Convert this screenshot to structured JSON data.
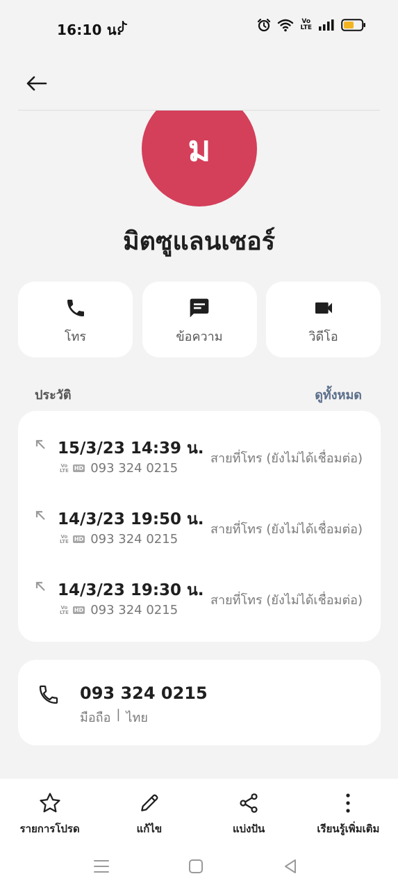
{
  "status_bar": {
    "time": "16:10 น.",
    "volte_top": "Vo",
    "volte_bottom": "LTE"
  },
  "contact": {
    "avatar_letter": "ม",
    "avatar_color": "#d43f5a",
    "name": "มิตซูแลนเซอร์"
  },
  "actions": [
    {
      "label": "โทร",
      "icon": "phone-icon"
    },
    {
      "label": "ข้อความ",
      "icon": "message-icon"
    },
    {
      "label": "วิดีโอ",
      "icon": "video-icon"
    }
  ],
  "history": {
    "title": "ประวัติ",
    "view_all": "ดูทั้งหมด",
    "calls": [
      {
        "datetime": "15/3/23 14:39 น.",
        "number": "093 324 0215",
        "status": "สายที่โทร (ยังไม่ได้เชื่อมต่อ)",
        "volte_top": "Vo",
        "volte_bottom": "LTE",
        "hd": "HD"
      },
      {
        "datetime": "14/3/23 19:50 น.",
        "number": "093 324 0215",
        "status": "สายที่โทร (ยังไม่ได้เชื่อมต่อ)",
        "volte_top": "Vo",
        "volte_bottom": "LTE",
        "hd": "HD"
      },
      {
        "datetime": "14/3/23 19:30 น.",
        "number": "093 324 0215",
        "status": "สายที่โทร (ยังไม่ได้เชื่อมต่อ)",
        "volte_top": "Vo",
        "volte_bottom": "LTE",
        "hd": "HD"
      }
    ]
  },
  "phone": {
    "number": "093 324 0215",
    "type": "มือถือ",
    "separator": "|",
    "region": "ไทย"
  },
  "bottom_bar": [
    {
      "label": "รายการโปรด",
      "icon": "star-icon"
    },
    {
      "label": "แก้ไข",
      "icon": "pencil-icon"
    },
    {
      "label": "แบ่งปัน",
      "icon": "share-icon"
    },
    {
      "label": "เรียนรู้เพิ่มเติม",
      "icon": "more-vertical-icon"
    }
  ],
  "colors": {
    "background": "#f3f3f3",
    "card": "#ffffff",
    "link": "#5b6f8b"
  }
}
